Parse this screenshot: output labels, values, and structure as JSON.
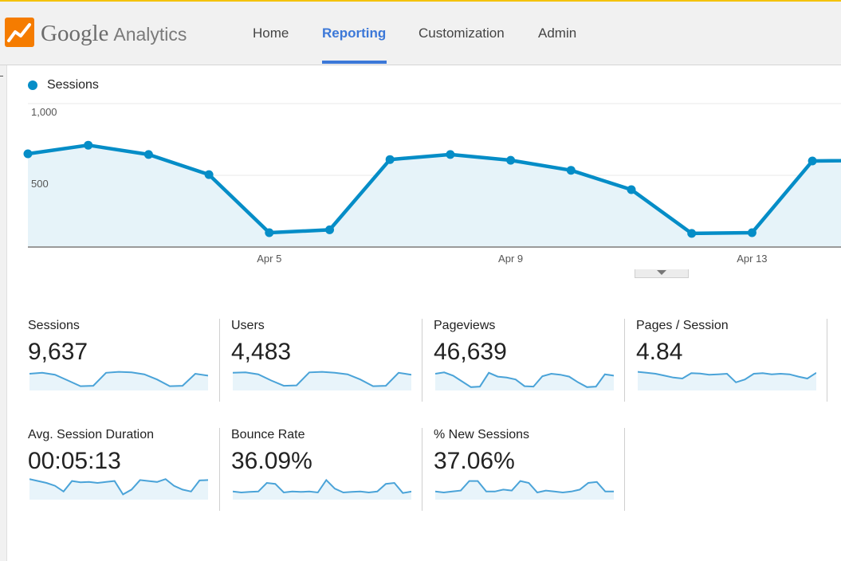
{
  "header": {
    "logo_brand": "Google",
    "logo_product": "Analytics",
    "nav": [
      {
        "label": "Home",
        "active": false
      },
      {
        "label": "Reporting",
        "active": true
      },
      {
        "label": "Customization",
        "active": false
      },
      {
        "label": "Admin",
        "active": false
      }
    ]
  },
  "colors": {
    "accent": "#3c78d8",
    "series": "#058dc7",
    "area_fill": "#e6f3f9",
    "spark": "#4aa3d8"
  },
  "chart_data": {
    "type": "line",
    "legend": "top-left",
    "series": [
      {
        "name": "Sessions",
        "values": [
          650,
          710,
          645,
          505,
          100,
          120,
          610,
          645,
          605,
          535,
          400,
          95,
          100,
          600,
          605
        ]
      }
    ],
    "y_ticks": [
      "500",
      "1,000"
    ],
    "ylim": [
      0,
      1000
    ],
    "x_tick_labels": [
      {
        "index": 4,
        "label": "Apr 5"
      },
      {
        "index": 8,
        "label": "Apr 9"
      },
      {
        "index": 12,
        "label": "Apr 13"
      }
    ],
    "grid": true
  },
  "metrics": [
    {
      "label": "Sessions",
      "value": "9,637",
      "spark": [
        0.75,
        0.8,
        0.7,
        0.4,
        0.1,
        0.12,
        0.8,
        0.85,
        0.82,
        0.72,
        0.45,
        0.1,
        0.12,
        0.75,
        0.65
      ]
    },
    {
      "label": "Users",
      "value": "4,483",
      "spark": [
        0.8,
        0.82,
        0.72,
        0.4,
        0.12,
        0.14,
        0.82,
        0.85,
        0.8,
        0.72,
        0.45,
        0.1,
        0.12,
        0.8,
        0.7
      ]
    },
    {
      "label": "Pageviews",
      "value": "46,639",
      "spark": [
        0.75,
        0.82,
        0.65,
        0.35,
        0.05,
        0.08,
        0.8,
        0.6,
        0.55,
        0.45,
        0.1,
        0.08,
        0.62,
        0.75,
        0.7,
        0.6,
        0.3,
        0.05,
        0.08,
        0.72,
        0.65
      ]
    },
    {
      "label": "Pages / Session",
      "value": "4.84",
      "spark": [
        0.85,
        0.8,
        0.75,
        0.65,
        0.55,
        0.5,
        0.78,
        0.76,
        0.7,
        0.72,
        0.75,
        0.3,
        0.45,
        0.75,
        0.78,
        0.72,
        0.75,
        0.72,
        0.6,
        0.5,
        0.8
      ]
    },
    {
      "label": "Avg. Session Duration",
      "value": "00:05:13",
      "spark": [
        0.95,
        0.85,
        0.75,
        0.6,
        0.3,
        0.85,
        0.78,
        0.8,
        0.75,
        0.8,
        0.85,
        0.15,
        0.4,
        0.9,
        0.85,
        0.8,
        0.95,
        0.6,
        0.4,
        0.3,
        0.88,
        0.9
      ]
    },
    {
      "label": "Bounce Rate",
      "value": "36.09%",
      "spark": [
        0.3,
        0.25,
        0.28,
        0.3,
        0.75,
        0.7,
        0.25,
        0.3,
        0.28,
        0.3,
        0.25,
        0.9,
        0.45,
        0.25,
        0.28,
        0.3,
        0.25,
        0.3,
        0.7,
        0.75,
        0.22,
        0.3
      ]
    },
    {
      "label": "% New Sessions",
      "value": "37.06%",
      "spark": [
        0.3,
        0.25,
        0.3,
        0.35,
        0.85,
        0.85,
        0.3,
        0.3,
        0.4,
        0.35,
        0.85,
        0.75,
        0.25,
        0.35,
        0.3,
        0.25,
        0.3,
        0.4,
        0.75,
        0.8,
        0.3,
        0.3
      ]
    }
  ]
}
